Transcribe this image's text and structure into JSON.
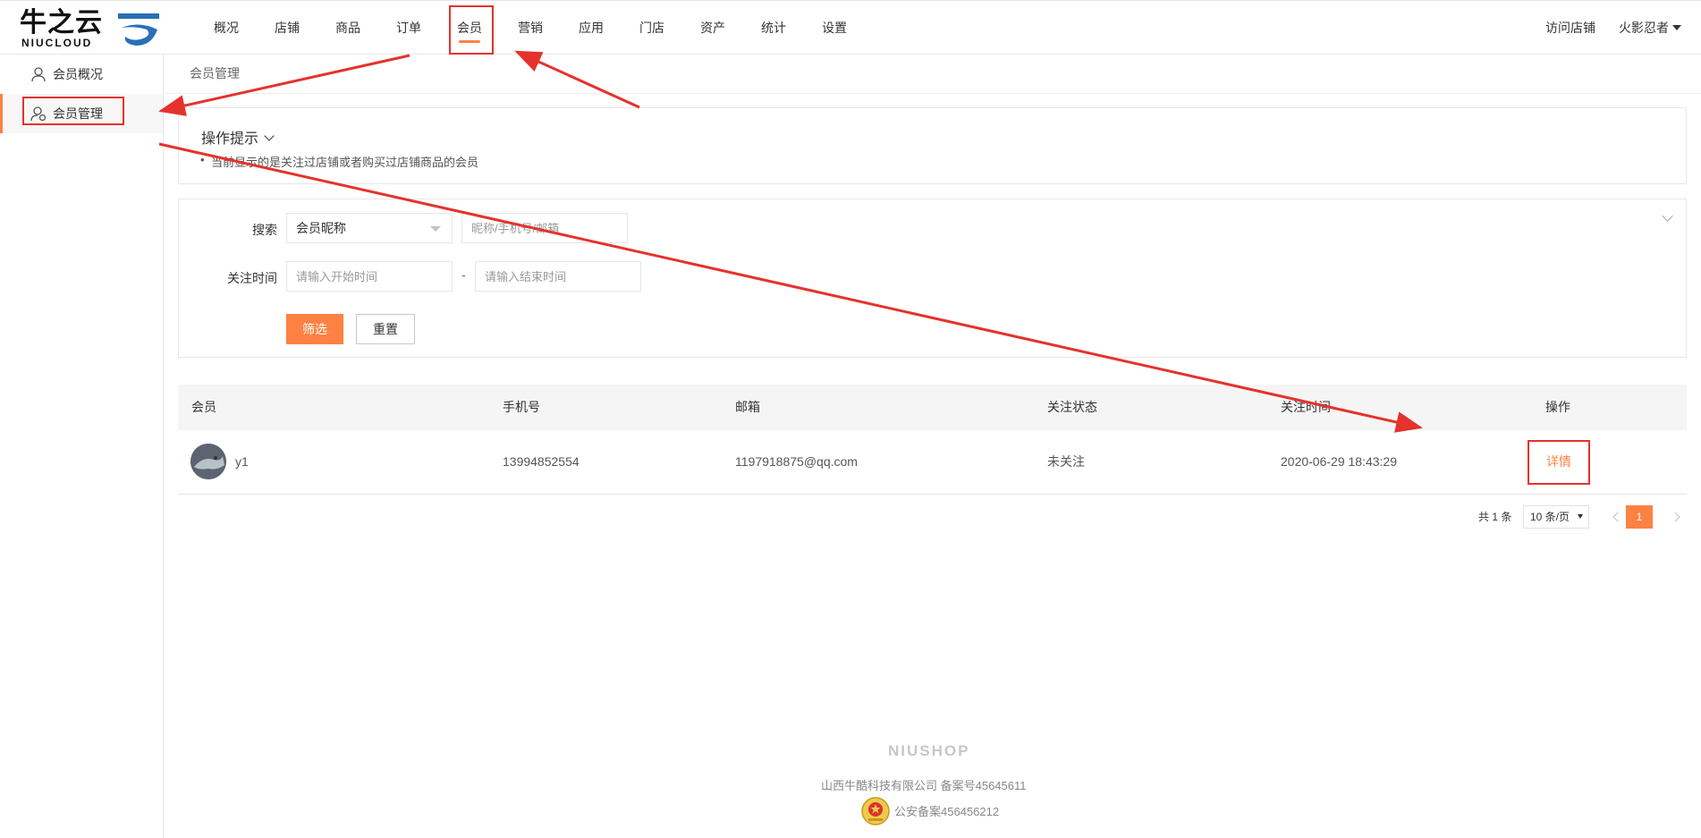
{
  "header": {
    "logo_text": "牛之云",
    "logo_sub": "NIUCLOUD",
    "nav": [
      {
        "label": "概况"
      },
      {
        "label": "店铺"
      },
      {
        "label": "商品"
      },
      {
        "label": "订单"
      },
      {
        "label": "会员",
        "active": true
      },
      {
        "label": "营销"
      },
      {
        "label": "应用"
      },
      {
        "label": "门店"
      },
      {
        "label": "资产"
      },
      {
        "label": "统计"
      },
      {
        "label": "设置"
      }
    ],
    "visit_shop": "访问店铺",
    "user_name": "火影忍者"
  },
  "sidebar": {
    "items": [
      {
        "label": "会员概况",
        "icon": "user-icon"
      },
      {
        "label": "会员管理",
        "icon": "user-settings-icon",
        "active": true
      }
    ]
  },
  "breadcrumb": "会员管理",
  "tips": {
    "title": "操作提示",
    "lines": [
      "当前显示的是关注过店铺或者购买过店铺商品的会员"
    ]
  },
  "filter": {
    "search_label": "搜索",
    "search_type": "会员昵称",
    "keyword_placeholder": "昵称/手机号/邮箱",
    "time_label": "关注时间",
    "start_placeholder": "请输入开始时间",
    "dash": "-",
    "end_placeholder": "请输入结束时间",
    "submit_label": "筛选",
    "reset_label": "重置"
  },
  "table": {
    "columns": [
      "会员",
      "手机号",
      "邮箱",
      "关注状态",
      "关注时间",
      "操作"
    ],
    "rows": [
      {
        "nickname": "y1",
        "phone": "13994852554",
        "email": "1197918875@qq.com",
        "status": "未关注",
        "follow_time": "2020-06-29 18:43:29",
        "action": "详情"
      }
    ]
  },
  "pagination": {
    "total": "共 1 条",
    "page_size": "10 条/页",
    "current_page": "1"
  },
  "footer": {
    "brand": "NIUSHOP",
    "company": "山西牛酷科技有限公司  备案号45645611",
    "police": "公安备案456456212"
  },
  "colors": {
    "accent": "#ff8143",
    "annotation": "#e5322d"
  }
}
